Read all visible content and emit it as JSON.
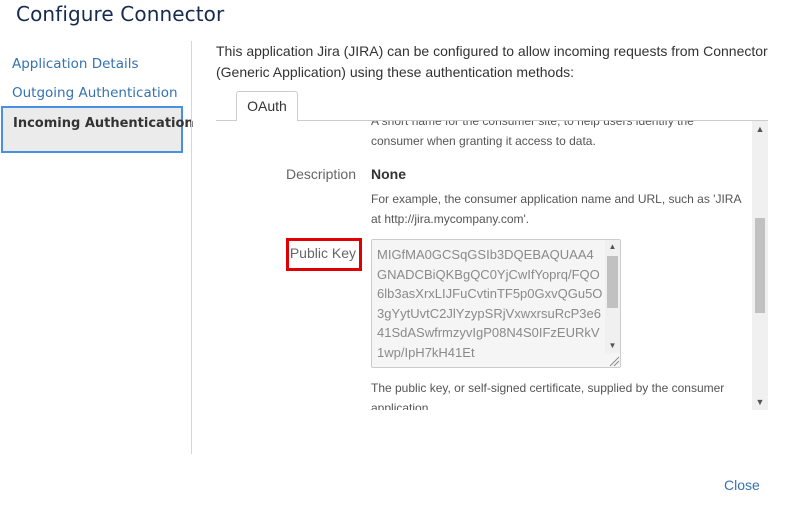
{
  "dialog": {
    "title": "Configure Connector"
  },
  "sidebar": {
    "items": [
      {
        "label": "Application Details"
      },
      {
        "label": "Outgoing Authentication"
      },
      {
        "label": "Incoming Authentication"
      }
    ]
  },
  "main": {
    "intro": "This application Jira (JIRA) can be configured to allow incoming requests from Connector (Generic Application) using these authentication methods:",
    "tabs": [
      {
        "label": "OAuth"
      }
    ],
    "fields": {
      "consumer_name_help": "A short name for the consumer site, to help users identify the consumer when granting it access to data.",
      "description": {
        "label": "Description",
        "value": "None",
        "help": "For example, the consumer application name and URL, such as 'JIRA at http://jira.mycompany.com'."
      },
      "public_key": {
        "label": "Public Key",
        "value": "MIGfMA0GCSqGSIb3DQEBAQUAA4GNADCBiQKBgQC0YjCwIfYoprq/FQO6lb3asXrxLIJFuCvtinTF5p0GxvQGu5O3gYytUvtC2JlYzypSRjVxwxrsuRcP3e641SdASwfrmzyvIgP08N4S0IFzEURkV1wp/IpH7kH41Et",
        "help": "The public key, or self-signed certificate, supplied by the consumer application."
      }
    }
  },
  "footer": {
    "close_label": "Close"
  },
  "colors": {
    "link": "#3572b0",
    "highlight": "#e00000",
    "active_border": "#4a90e2"
  },
  "icons": {
    "scroll_up": "▲",
    "scroll_down": "▼"
  }
}
